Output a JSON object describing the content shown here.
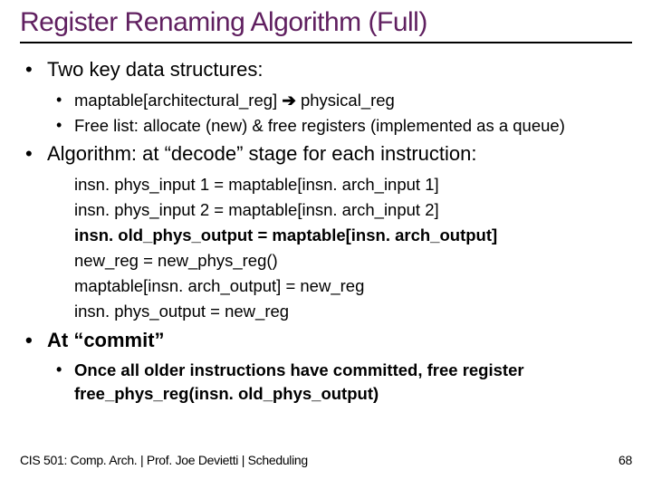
{
  "title": "Register Renaming Algorithm (Full)",
  "bullets": {
    "b0": "Two key data structures:",
    "b0_sub": {
      "a_pre": "maptable[architectural_reg]  ",
      "a_arrow": "➔",
      "a_post": "  physical_reg",
      "b": "Free list: allocate (new) & free registers (implemented as a queue)"
    },
    "b1": "Algorithm: at “decode” stage for each instruction:",
    "b1_sub": {
      "a": "insn. phys_input 1 = maptable[insn. arch_input 1]",
      "b": "insn. phys_input 2 = maptable[insn. arch_input 2]",
      "c": "insn. old_phys_output = maptable[insn. arch_output]",
      "d": "new_reg = new_phys_reg()",
      "e": "maptable[insn. arch_output] = new_reg",
      "f": "insn. phys_output = new_reg"
    },
    "b2": "At “commit”",
    "b2_sub": {
      "a": "Once all older instructions have committed, free register free_phys_reg(insn. old_phys_output)"
    }
  },
  "footer": {
    "left": "CIS 501: Comp. Arch.  |  Prof. Joe Devietti  |  Scheduling",
    "right": "68"
  }
}
